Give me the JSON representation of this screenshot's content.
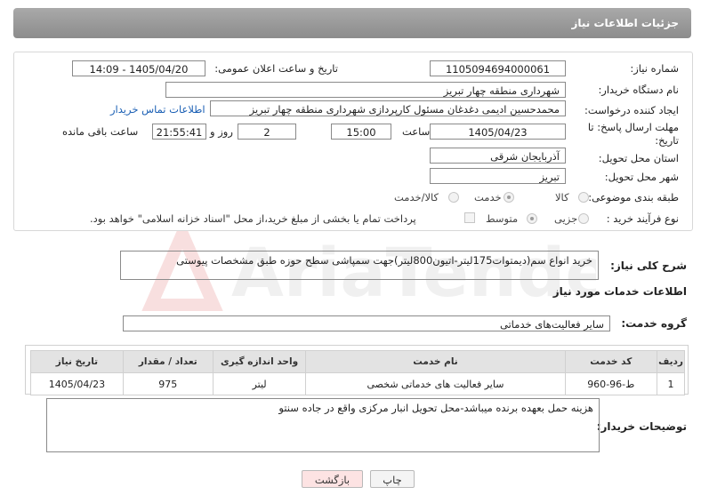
{
  "header": {
    "title": "جزئیات اطلاعات نیاز"
  },
  "form": {
    "need_number_label": "شماره نیاز:",
    "need_number_value": "1105094694000061",
    "announce_datetime_label": "تاریخ و ساعت اعلان عمومی:",
    "announce_datetime_value": "1405/04/20 - 14:09",
    "buyer_org_label": "نام دستگاه خریدار:",
    "buyer_org_value": "شهرداری منطقه چهار تبریز",
    "requester_label": "ایجاد کننده درخواست:",
    "requester_value": "محمدحسین ادیمی دغدغان مسئول کارپردازی شهرداری منطقه چهار تبریز",
    "buyer_contact_link": "اطلاعات تماس خریدار",
    "deadline_label_line1": "مهلت ارسال پاسخ: تا",
    "deadline_label_line2": "تاریخ:",
    "deadline_date": "1405/04/23",
    "time_label": "ساعت",
    "deadline_time": "15:00",
    "days_value": "2",
    "days_label": "روز و",
    "remaining_time": "21:55:41",
    "remaining_label": "ساعت باقی مانده",
    "province_label": "استان محل تحویل:",
    "province_value": "آذربایجان شرقی",
    "city_label": "شهر محل تحویل:",
    "city_value": "تبریز",
    "category_label": "طبقه بندی موضوعی:",
    "category_options": [
      "کالا",
      "خدمت",
      "کالا/خدمت"
    ],
    "category_selected": "خدمت",
    "process_label": "نوع فرآیند خرید :",
    "process_options": [
      "جزیی",
      "متوسط"
    ],
    "process_selected": "متوسط",
    "treasury_note": "پرداخت تمام یا بخشی از مبلغ خرید،از محل \"اسناد خزانه اسلامی\" خواهد بود."
  },
  "summary": {
    "label": "شرح کلی نیاز:",
    "value": "خرید انواع سم(دیمتوات175لیتر-اتیون800لیتر)جهت سمپاشی سطح حوزه طبق مشخصات پیوستی"
  },
  "services": {
    "section_title": "اطلاعات خدمات مورد نیاز",
    "group_label": "گروه خدمت:",
    "group_value": "سایر فعالیت‌های خدماتی",
    "columns": [
      "ردیف",
      "کد خدمت",
      "نام خدمت",
      "واحد اندازه گیری",
      "تعداد / مقدار",
      "تاریخ نیاز"
    ],
    "rows": [
      [
        "1",
        "ط-96-960",
        "سایر فعالیت های خدماتی شخصی",
        "لیتر",
        "975",
        "1405/04/23"
      ]
    ]
  },
  "buyer_notes": {
    "label": "توضیحات خریدار:",
    "value": "هزینه حمل بعهده برنده میباشد-محل تحویل انبار مرکزی واقع در جاده سنتو"
  },
  "buttons": {
    "print": "چاپ",
    "back": "بازگشت"
  },
  "watermark_text": "AriaTender.net",
  "colors": {
    "header": "#999999",
    "link": "#1a5fb4",
    "back_button_bg": "#fde3e3"
  }
}
